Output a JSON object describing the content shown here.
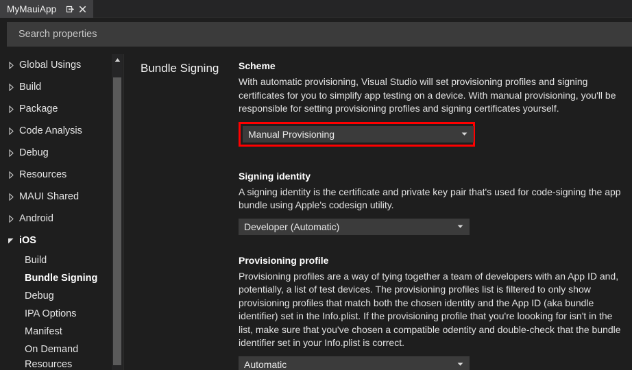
{
  "window": {
    "tab": {
      "title": "MyMauiApp",
      "pin_icon": "pin-icon",
      "close_icon": "close-icon"
    }
  },
  "search": {
    "placeholder": "Search properties",
    "value": ""
  },
  "sidebar": {
    "items": [
      {
        "label": "Global Usings",
        "level": 1,
        "state": "collapsed"
      },
      {
        "label": "Build",
        "level": 1,
        "state": "collapsed"
      },
      {
        "label": "Package",
        "level": 1,
        "state": "collapsed"
      },
      {
        "label": "Code Analysis",
        "level": 1,
        "state": "collapsed"
      },
      {
        "label": "Debug",
        "level": 1,
        "state": "collapsed"
      },
      {
        "label": "Resources",
        "level": 1,
        "state": "collapsed"
      },
      {
        "label": "MAUI Shared",
        "level": 1,
        "state": "collapsed"
      },
      {
        "label": "Android",
        "level": 1,
        "state": "collapsed"
      },
      {
        "label": "iOS",
        "level": 1,
        "state": "expanded"
      },
      {
        "label": "Build",
        "level": 2,
        "state": "leaf"
      },
      {
        "label": "Bundle Signing",
        "level": 2,
        "state": "selected"
      },
      {
        "label": "Debug",
        "level": 2,
        "state": "leaf"
      },
      {
        "label": "IPA Options",
        "level": 2,
        "state": "leaf"
      },
      {
        "label": "Manifest",
        "level": 2,
        "state": "leaf"
      },
      {
        "label": "On Demand Resources",
        "level": 2,
        "state": "leaf"
      }
    ],
    "scrollbar": {
      "up_arrow_icon": "scroll-up-arrow-icon"
    }
  },
  "page": {
    "title": "Bundle Signing",
    "sections": {
      "scheme": {
        "title": "Scheme",
        "description": "With automatic provisioning, Visual Studio will set provisioning profiles and signing certificates for you to simplify app testing on a device. With manual provisioning, you'll be responsible for setting provisioning profiles and signing certificates yourself.",
        "dropdown_value": "Manual Provisioning",
        "highlight_color": "#ff0000"
      },
      "signing_identity": {
        "title": "Signing identity",
        "description": "A signing identity is the certificate and private key pair that's used for code-signing the app bundle using Apple's codesign utility.",
        "dropdown_value": "Developer (Automatic)"
      },
      "provisioning_profile": {
        "title": "Provisioning profile",
        "description": "Provisioning profiles are a way of tying together a team of developers with an App ID and, potentially, a list of test devices. The provisioning profiles list is filtered to only show provisioning profiles that match both the chosen identity and the App ID (aka bundle identifier) set in the Info.plist. If the provisioning profile that you're loooking for isn't in the list, make sure that you've chosen a compatible odentity and double-check that the bundle identifier set in your Info.plist is correct.",
        "dropdown_value": "Automatic"
      }
    }
  },
  "theme": {
    "background": "#1e1e1e",
    "panel_background": "#252526",
    "input_background": "#3b3b3b",
    "tab_active_background": "#3f3f41",
    "text": "#e6e6e6",
    "accent_highlight": "#ff0000"
  }
}
